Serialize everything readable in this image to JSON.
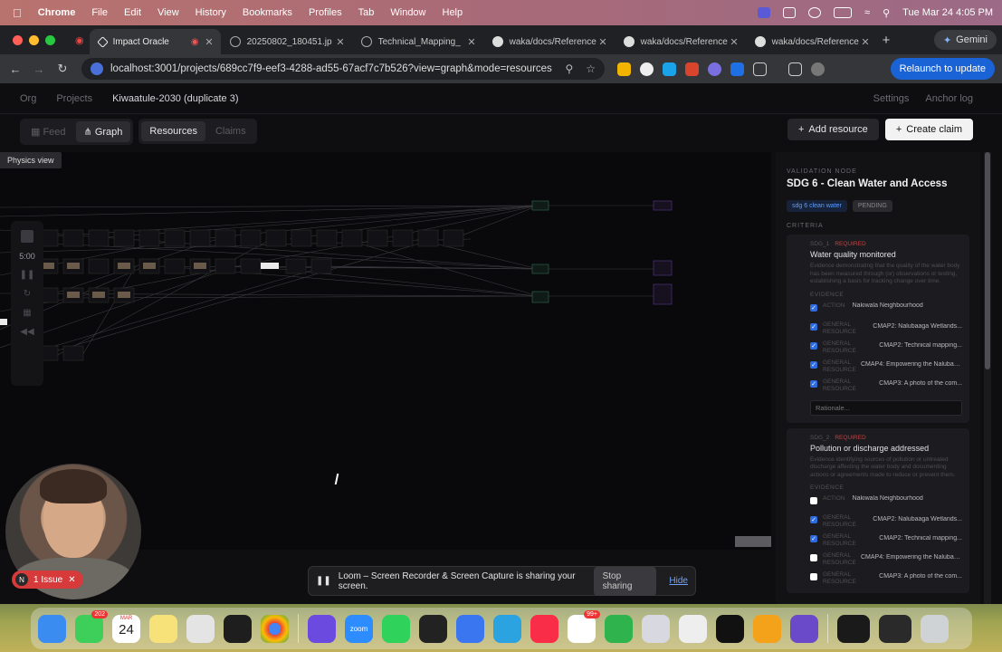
{
  "menubar": {
    "app": "Chrome",
    "items": [
      "File",
      "Edit",
      "View",
      "History",
      "Bookmarks",
      "Profiles",
      "Tab",
      "Window",
      "Help"
    ],
    "clock": "Tue Mar 24  4:05 PM"
  },
  "tabs": [
    {
      "title": "Impact Oracle",
      "active": true
    },
    {
      "title": "20250802_180451.jp"
    },
    {
      "title": "Technical_Mapping_"
    },
    {
      "title": "waka/docs/Reference"
    },
    {
      "title": "waka/docs/Reference"
    },
    {
      "title": "waka/docs/Reference"
    }
  ],
  "gemini_label": "Gemini",
  "url": "localhost:3001/projects/689cc7f9-eef3-4288-ad55-67acf7c7b526?view=graph&mode=resources",
  "relaunch_label": "Relaunch to update",
  "app": {
    "breadcrumb": [
      "Org",
      "Projects",
      "Kiwaatule-2030 (duplicate 3)"
    ],
    "top_right": [
      "Settings",
      "Anchor log"
    ],
    "view_tabs": [
      "Feed",
      "Graph"
    ],
    "mode_tabs": [
      "Resources",
      "Claims"
    ],
    "add_resource": "Add resource",
    "create_claim": "Create claim",
    "physics_tooltip": "Physics view",
    "timer": "5:00"
  },
  "panel": {
    "eyebrow": "VALIDATION NODE",
    "title": "SDG 6 - Clean Water and Access",
    "tag_primary": "sdg 6 clean water",
    "tag_status": "PENDING",
    "criteria_label": "CRITERIA",
    "cards": [
      {
        "id": "SDG_1",
        "req": "REQUIRED",
        "title": "Water quality monitored",
        "desc": "Evidence demonstrating that the quality of the water body has been measured through (or) observations or testing, establishing a basis for tracking change over time.",
        "evidence_label": "EVIDENCE",
        "evidence": [
          {
            "type": "ACTION",
            "text": "Nakiwala Neighbourhood",
            "checked": true
          },
          {
            "type": "GENERAL RESOURCE",
            "text": "CMAP2: Nalubaaga Wetlands...",
            "checked": true
          },
          {
            "type": "GENERAL RESOURCE",
            "text": "CMAP2: Technical mapping...",
            "checked": true
          },
          {
            "type": "GENERAL RESOURCE",
            "text": "CMAP4: Empowering the Nalubaa...",
            "checked": true
          },
          {
            "type": "GENERAL RESOURCE",
            "text": "CMAP3: A photo of the com...",
            "checked": true
          }
        ],
        "rationale": "Rationale..."
      },
      {
        "id": "SDG_2",
        "req": "REQUIRED",
        "title": "Pollution or discharge addressed",
        "desc": "Evidence identifying sources of pollution or untreated discharge affecting the water body and documenting actions or agreements made to reduce or prevent them.",
        "evidence_label": "EVIDENCE",
        "evidence": [
          {
            "type": "ACTION",
            "text": "Nakiwala Neighbourhood",
            "checked": false
          },
          {
            "type": "GENERAL RESOURCE",
            "text": "CMAP2: Nalubaaga Wetlands...",
            "checked": true
          },
          {
            "type": "GENERAL RESOURCE",
            "text": "CMAP2: Technical mapping...",
            "checked": true
          },
          {
            "type": "GENERAL RESOURCE",
            "text": "CMAP4: Empowering the Nalubaa...",
            "checked": false
          },
          {
            "type": "GENERAL RESOURCE",
            "text": "CMAP3: A photo of the com...",
            "checked": false
          }
        ]
      }
    ]
  },
  "loom": {
    "message": "Loom – Screen Recorder & Screen Capture is sharing your screen.",
    "stop": "Stop sharing",
    "hide": "Hide"
  },
  "issue_label": "1 Issue",
  "dock": {
    "badges": {
      "messages": "202",
      "calendar_month": "MAR",
      "calendar_day": "24",
      "notion": "99+"
    },
    "zoom_label": "zoom"
  }
}
